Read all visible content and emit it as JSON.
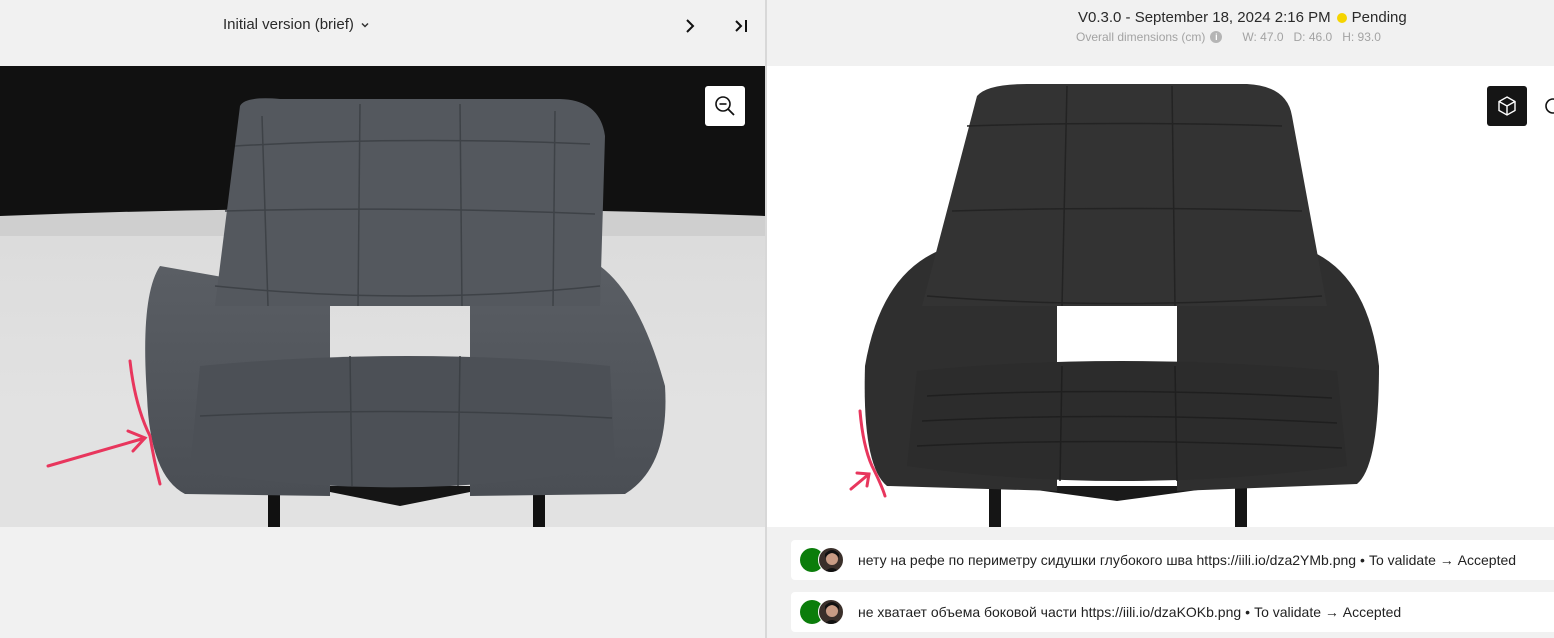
{
  "left": {
    "version_label": "Initial version (brief)",
    "icons": {
      "dropdown": "chevron-down-icon",
      "next": "chevron-right-icon",
      "last": "skip-to-end-icon",
      "zoom": "zoom-out-icon"
    }
  },
  "right": {
    "version": "V0.3.0 - September 18, 2024 2:16 PM",
    "status": "Pending",
    "status_color": "#f5d400",
    "dims_label": "Overall dimensions (cm)",
    "dims": {
      "w": "W: 47.0",
      "d": "D: 46.0",
      "h": "H: 93.0"
    },
    "icons": {
      "info": "info-icon",
      "model_view": "cube-icon",
      "zoom": "zoom-icon"
    }
  },
  "comments": [
    {
      "text": "нету на рефе по периметру сидушки глубокого шва",
      "link": "https://iili.io/dza2YMb.png",
      "from": "To validate",
      "arrow": "→",
      "to": "Accepted"
    },
    {
      "text": "не хватает объема боковой части",
      "link": "https://iili.io/dzaKOKb.png",
      "from": "To validate",
      "arrow": "→",
      "to": "Accepted"
    }
  ],
  "colors": {
    "accent_dark": "#151515",
    "avatar_green": "#0b7d0b",
    "annotation": "#e8365d"
  }
}
